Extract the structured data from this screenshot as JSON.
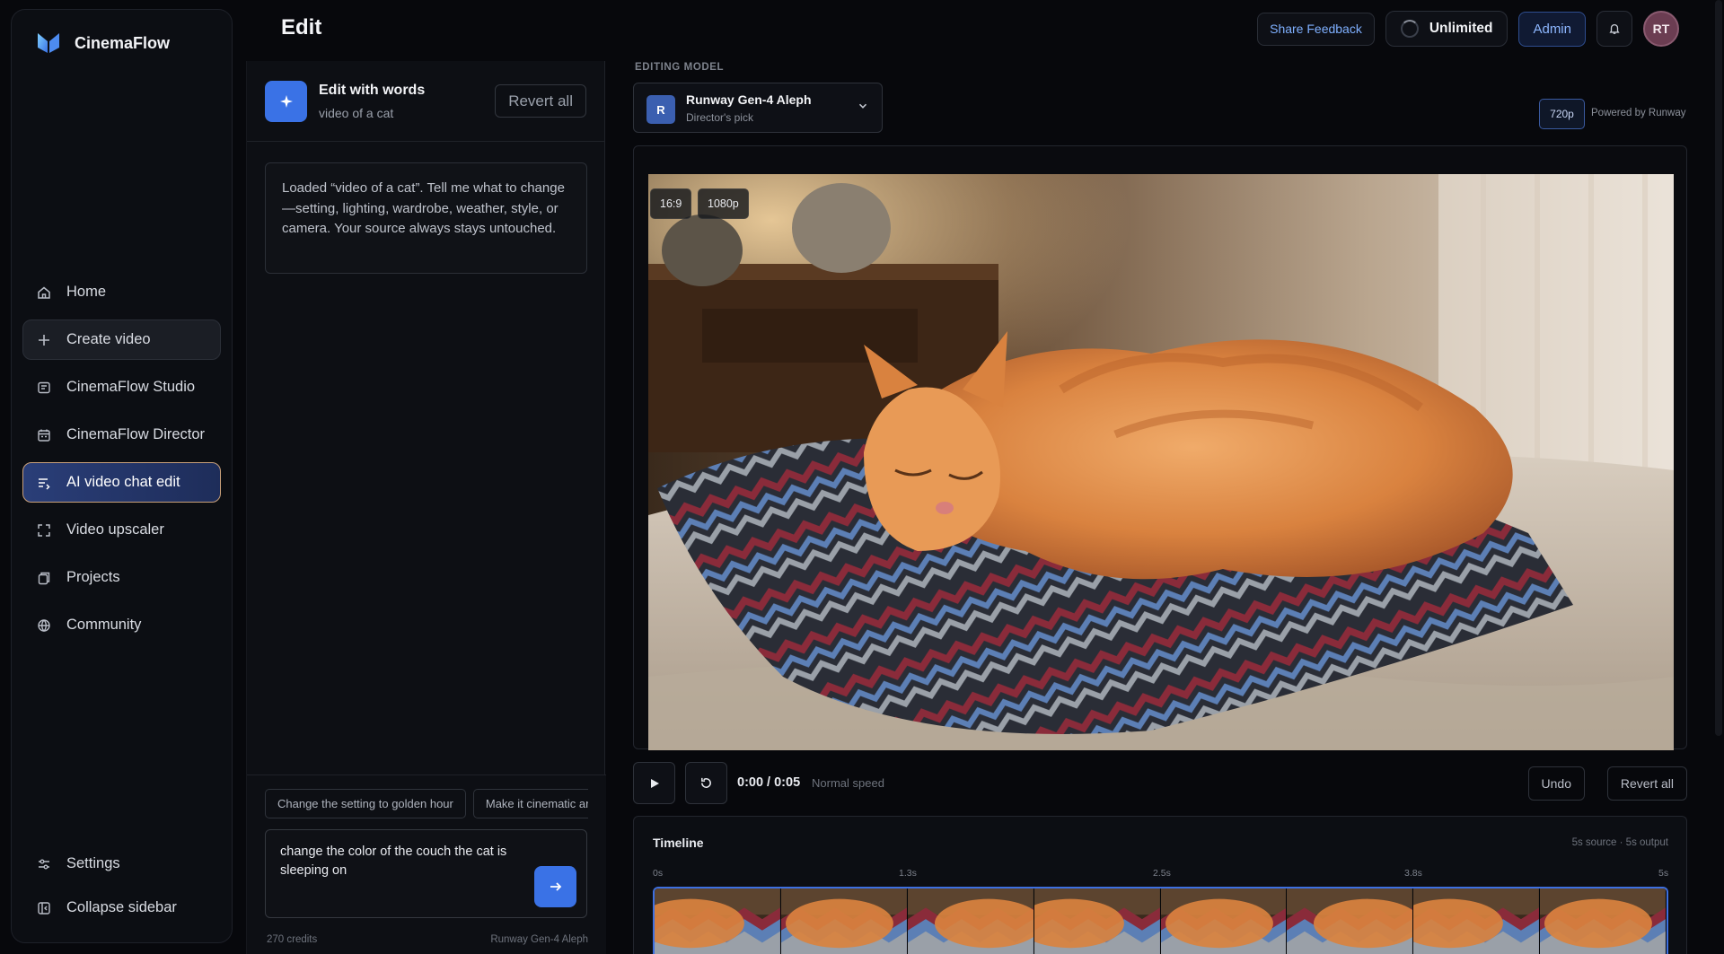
{
  "app": {
    "name": "CinemaFlow"
  },
  "page": {
    "title": "Edit"
  },
  "sidebar": {
    "items": [
      {
        "label": "Home",
        "icon": "home-icon"
      },
      {
        "label": "Create video",
        "icon": "plus-icon"
      },
      {
        "label": "CinemaFlow Studio",
        "icon": "studio-icon"
      },
      {
        "label": "CinemaFlow Director",
        "icon": "calendar-icon"
      },
      {
        "label": "AI video chat edit",
        "icon": "chat-edit-icon",
        "active": true
      },
      {
        "label": "Video upscaler",
        "icon": "expand-icon"
      },
      {
        "label": "Projects",
        "icon": "projects-icon"
      },
      {
        "label": "Community",
        "icon": "globe-icon"
      }
    ],
    "bottom": [
      {
        "label": "Settings",
        "icon": "sliders-icon"
      },
      {
        "label": "Collapse sidebar",
        "icon": "collapse-icon"
      }
    ]
  },
  "header": {
    "feedback": "Share Feedback",
    "plan": "Unlimited",
    "admin": "Admin",
    "avatar_initials": "RT"
  },
  "chat": {
    "title": "Edit with words",
    "subtitle": "video of a cat",
    "revert_all": "Revert all",
    "message": "Loaded “video of a cat”. Tell me what to change—setting, lighting, wardrobe, weather, style, or camera. Your source always stays untouched.",
    "suggestions": [
      "Change the setting to golden hour",
      "Make it cinematic and moody"
    ],
    "input_value": "change the color of the couch the cat is sleeping on",
    "credits": "270 credits",
    "model_footer": "Runway Gen-4 Aleph"
  },
  "editor": {
    "model_label": "EDITING MODEL",
    "model_badge": "R",
    "model_name": "Runway Gen-4 Aleph",
    "model_sub": "Director's pick",
    "resolution": "720p",
    "powered_by": "Powered by Runway",
    "aspect_tag": "16:9",
    "res_tag": "1080p",
    "time": "0:00 / 0:05",
    "speed": "Normal speed",
    "undo": "Undo",
    "revert_all": "Revert all"
  },
  "timeline": {
    "title": "Timeline",
    "meta": "5s source · 5s output",
    "ticks": [
      "0s",
      "1.3s",
      "2.5s",
      "3.8s",
      "5s"
    ],
    "frame_count": 8
  },
  "colors": {
    "accent": "#3a72e6",
    "active_nav": "#2a3e78",
    "admin": "#8db7ff",
    "link": "#7fb0ff"
  }
}
